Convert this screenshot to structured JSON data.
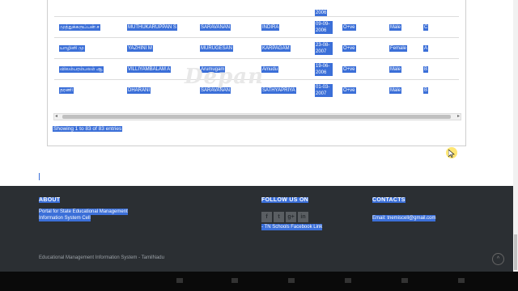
{
  "table": {
    "top_row_date": "2006",
    "rows": [
      {
        "name_tamil": "முத்துக்கருப்பன் ச",
        "name": "MUTHUKARUPPAN S",
        "father": "SARAVANAN",
        "mother": "INDIRA",
        "dob": "09-09-2006",
        "blood": "O+ve",
        "gender": "Male",
        "section": "C"
      },
      {
        "name_tamil": "யாழினி மு",
        "name": "YAZHINI M",
        "father": "MURUGESAN",
        "mother": "KARPAGAM",
        "dob": "23-08-2007",
        "blood": "O+ve",
        "gender": "Female",
        "section": "A"
      },
      {
        "name_tamil": "விலம்பரம்பலம் ஆ",
        "name": "VILLIYAMBALAM A",
        "father": "Arumugam",
        "mother": "Amudu",
        "dob": "19-06-2006",
        "blood": "O+ve",
        "gender": "Male",
        "section": "B"
      },
      {
        "name_tamil": "தரணி",
        "name": "DHARANI",
        "father": "SARAVANAN",
        "mother": "SATHYAPRIYA",
        "dob": "01-03-2007",
        "blood": "O+ve",
        "gender": "Male",
        "section": "B"
      }
    ]
  },
  "showing_text": "Showing 1 to 83 of 83 entries",
  "watermark": "Depan",
  "footer": {
    "about_heading": "ABOUT",
    "about_text_1": "Portal for State Educational Management",
    "about_text_2": "Information System Cell",
    "follow_heading": "FOLLOW US ON",
    "facebook_link": "- TN Schools Facebook Link",
    "social_icons": [
      "f",
      "t",
      "g+",
      "in"
    ],
    "contacts_heading": "CONTACTS",
    "email": "Email: tnemiscell@gmail.com",
    "copyright": "Educational Management Information System - TamilNadu",
    "totop": "^"
  },
  "colors": {
    "selection": "#3b6fd8",
    "footer_bg": "#2b2f33"
  }
}
